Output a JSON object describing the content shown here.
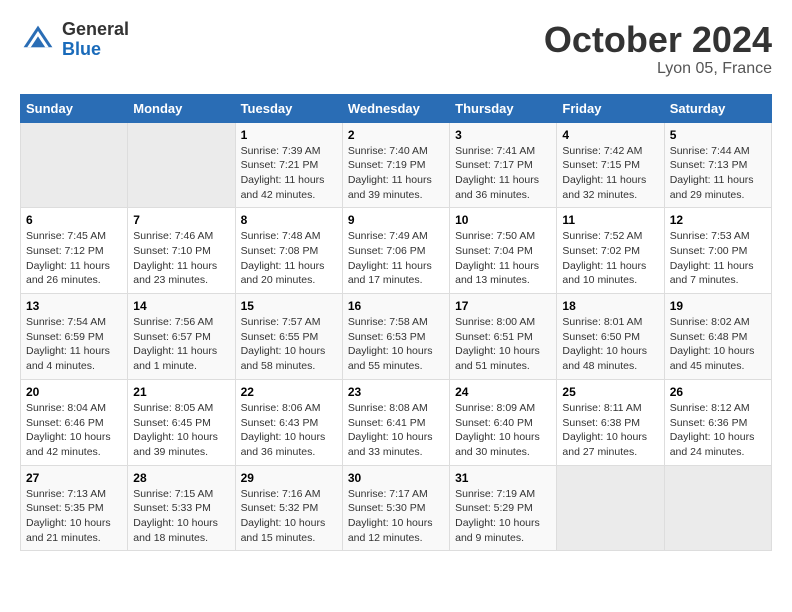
{
  "header": {
    "logo_line1": "General",
    "logo_line2": "Blue",
    "month": "October 2024",
    "location": "Lyon 05, France"
  },
  "weekdays": [
    "Sunday",
    "Monday",
    "Tuesday",
    "Wednesday",
    "Thursday",
    "Friday",
    "Saturday"
  ],
  "weeks": [
    [
      {
        "day": "",
        "sunrise": "",
        "sunset": "",
        "daylight": ""
      },
      {
        "day": "",
        "sunrise": "",
        "sunset": "",
        "daylight": ""
      },
      {
        "day": "1",
        "sunrise": "Sunrise: 7:39 AM",
        "sunset": "Sunset: 7:21 PM",
        "daylight": "Daylight: 11 hours and 42 minutes."
      },
      {
        "day": "2",
        "sunrise": "Sunrise: 7:40 AM",
        "sunset": "Sunset: 7:19 PM",
        "daylight": "Daylight: 11 hours and 39 minutes."
      },
      {
        "day": "3",
        "sunrise": "Sunrise: 7:41 AM",
        "sunset": "Sunset: 7:17 PM",
        "daylight": "Daylight: 11 hours and 36 minutes."
      },
      {
        "day": "4",
        "sunrise": "Sunrise: 7:42 AM",
        "sunset": "Sunset: 7:15 PM",
        "daylight": "Daylight: 11 hours and 32 minutes."
      },
      {
        "day": "5",
        "sunrise": "Sunrise: 7:44 AM",
        "sunset": "Sunset: 7:13 PM",
        "daylight": "Daylight: 11 hours and 29 minutes."
      }
    ],
    [
      {
        "day": "6",
        "sunrise": "Sunrise: 7:45 AM",
        "sunset": "Sunset: 7:12 PM",
        "daylight": "Daylight: 11 hours and 26 minutes."
      },
      {
        "day": "7",
        "sunrise": "Sunrise: 7:46 AM",
        "sunset": "Sunset: 7:10 PM",
        "daylight": "Daylight: 11 hours and 23 minutes."
      },
      {
        "day": "8",
        "sunrise": "Sunrise: 7:48 AM",
        "sunset": "Sunset: 7:08 PM",
        "daylight": "Daylight: 11 hours and 20 minutes."
      },
      {
        "day": "9",
        "sunrise": "Sunrise: 7:49 AM",
        "sunset": "Sunset: 7:06 PM",
        "daylight": "Daylight: 11 hours and 17 minutes."
      },
      {
        "day": "10",
        "sunrise": "Sunrise: 7:50 AM",
        "sunset": "Sunset: 7:04 PM",
        "daylight": "Daylight: 11 hours and 13 minutes."
      },
      {
        "day": "11",
        "sunrise": "Sunrise: 7:52 AM",
        "sunset": "Sunset: 7:02 PM",
        "daylight": "Daylight: 11 hours and 10 minutes."
      },
      {
        "day": "12",
        "sunrise": "Sunrise: 7:53 AM",
        "sunset": "Sunset: 7:00 PM",
        "daylight": "Daylight: 11 hours and 7 minutes."
      }
    ],
    [
      {
        "day": "13",
        "sunrise": "Sunrise: 7:54 AM",
        "sunset": "Sunset: 6:59 PM",
        "daylight": "Daylight: 11 hours and 4 minutes."
      },
      {
        "day": "14",
        "sunrise": "Sunrise: 7:56 AM",
        "sunset": "Sunset: 6:57 PM",
        "daylight": "Daylight: 11 hours and 1 minute."
      },
      {
        "day": "15",
        "sunrise": "Sunrise: 7:57 AM",
        "sunset": "Sunset: 6:55 PM",
        "daylight": "Daylight: 10 hours and 58 minutes."
      },
      {
        "day": "16",
        "sunrise": "Sunrise: 7:58 AM",
        "sunset": "Sunset: 6:53 PM",
        "daylight": "Daylight: 10 hours and 55 minutes."
      },
      {
        "day": "17",
        "sunrise": "Sunrise: 8:00 AM",
        "sunset": "Sunset: 6:51 PM",
        "daylight": "Daylight: 10 hours and 51 minutes."
      },
      {
        "day": "18",
        "sunrise": "Sunrise: 8:01 AM",
        "sunset": "Sunset: 6:50 PM",
        "daylight": "Daylight: 10 hours and 48 minutes."
      },
      {
        "day": "19",
        "sunrise": "Sunrise: 8:02 AM",
        "sunset": "Sunset: 6:48 PM",
        "daylight": "Daylight: 10 hours and 45 minutes."
      }
    ],
    [
      {
        "day": "20",
        "sunrise": "Sunrise: 8:04 AM",
        "sunset": "Sunset: 6:46 PM",
        "daylight": "Daylight: 10 hours and 42 minutes."
      },
      {
        "day": "21",
        "sunrise": "Sunrise: 8:05 AM",
        "sunset": "Sunset: 6:45 PM",
        "daylight": "Daylight: 10 hours and 39 minutes."
      },
      {
        "day": "22",
        "sunrise": "Sunrise: 8:06 AM",
        "sunset": "Sunset: 6:43 PM",
        "daylight": "Daylight: 10 hours and 36 minutes."
      },
      {
        "day": "23",
        "sunrise": "Sunrise: 8:08 AM",
        "sunset": "Sunset: 6:41 PM",
        "daylight": "Daylight: 10 hours and 33 minutes."
      },
      {
        "day": "24",
        "sunrise": "Sunrise: 8:09 AM",
        "sunset": "Sunset: 6:40 PM",
        "daylight": "Daylight: 10 hours and 30 minutes."
      },
      {
        "day": "25",
        "sunrise": "Sunrise: 8:11 AM",
        "sunset": "Sunset: 6:38 PM",
        "daylight": "Daylight: 10 hours and 27 minutes."
      },
      {
        "day": "26",
        "sunrise": "Sunrise: 8:12 AM",
        "sunset": "Sunset: 6:36 PM",
        "daylight": "Daylight: 10 hours and 24 minutes."
      }
    ],
    [
      {
        "day": "27",
        "sunrise": "Sunrise: 7:13 AM",
        "sunset": "Sunset: 5:35 PM",
        "daylight": "Daylight: 10 hours and 21 minutes."
      },
      {
        "day": "28",
        "sunrise": "Sunrise: 7:15 AM",
        "sunset": "Sunset: 5:33 PM",
        "daylight": "Daylight: 10 hours and 18 minutes."
      },
      {
        "day": "29",
        "sunrise": "Sunrise: 7:16 AM",
        "sunset": "Sunset: 5:32 PM",
        "daylight": "Daylight: 10 hours and 15 minutes."
      },
      {
        "day": "30",
        "sunrise": "Sunrise: 7:17 AM",
        "sunset": "Sunset: 5:30 PM",
        "daylight": "Daylight: 10 hours and 12 minutes."
      },
      {
        "day": "31",
        "sunrise": "Sunrise: 7:19 AM",
        "sunset": "Sunset: 5:29 PM",
        "daylight": "Daylight: 10 hours and 9 minutes."
      },
      {
        "day": "",
        "sunrise": "",
        "sunset": "",
        "daylight": ""
      },
      {
        "day": "",
        "sunrise": "",
        "sunset": "",
        "daylight": ""
      }
    ]
  ]
}
